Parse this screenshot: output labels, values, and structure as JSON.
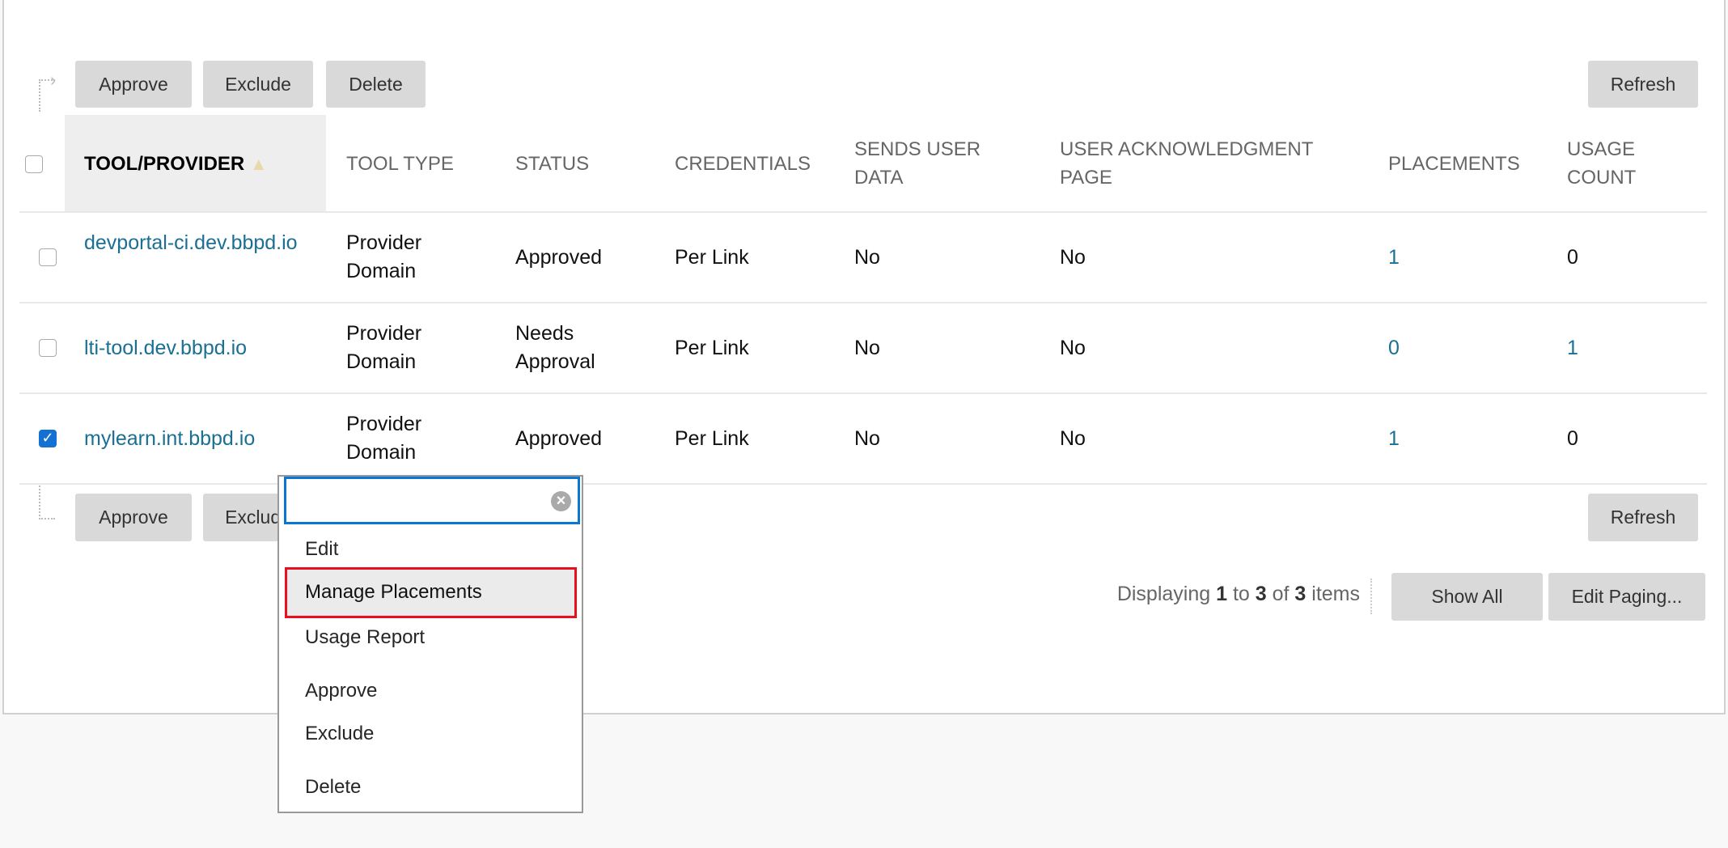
{
  "toolbar": {
    "approve": "Approve",
    "exclude": "Exclude",
    "delete": "Delete",
    "refresh": "Refresh"
  },
  "columns": [
    "TOOL/PROVIDER",
    "TOOL TYPE",
    "STATUS",
    "CREDENTIALS",
    "SENDS USER DATA",
    "USER ACKNOWLEDGMENT PAGE",
    "PLACEMENTS",
    "USAGE COUNT"
  ],
  "columns_lines": {
    "sends": [
      "SENDS USER",
      "DATA"
    ],
    "ack": [
      "USER ACKNOWLEDGMENT",
      "PAGE"
    ],
    "usage": [
      "USAGE",
      "COUNT"
    ]
  },
  "sort": {
    "column": "TOOL/PROVIDER",
    "direction": "ascending",
    "icon": "sort-up-triangle-icon"
  },
  "rows": [
    {
      "checked": false,
      "tool": "devportal-ci.dev.bbpd.io",
      "type": [
        "Provider",
        "Domain"
      ],
      "status": [
        "Approved"
      ],
      "credentials": "Per Link",
      "sends": "No",
      "ack": "No",
      "placements": "1",
      "usage": "0"
    },
    {
      "checked": false,
      "tool": "lti-tool.dev.bbpd.io",
      "type": [
        "Provider",
        "Domain"
      ],
      "status": [
        "Needs",
        "Approval"
      ],
      "credentials": "Per Link",
      "sends": "No",
      "ack": "No",
      "placements": "0",
      "usage": "1"
    },
    {
      "checked": true,
      "tool": "mylearn.int.bbpd.io",
      "type": [
        "Provider",
        "Domain"
      ],
      "status": [
        "Approved"
      ],
      "credentials": "Per Link",
      "sends": "No",
      "ack": "No",
      "placements": "1",
      "usage": "0"
    }
  ],
  "menu": {
    "search_value": "",
    "items": [
      "Edit",
      "Manage Placements",
      "Usage Report",
      "Approve",
      "Exclude",
      "Delete"
    ],
    "highlighted": "Manage Placements"
  },
  "paging": {
    "prefix": "Displaying ",
    "from": "1",
    "to_word": " to ",
    "to": "3",
    "of_word": " of ",
    "total": "3",
    "suffix": " items",
    "show_all": "Show All",
    "edit_paging": "Edit Paging..."
  },
  "colors": {
    "link": "#1a6f94",
    "focus": "#0a78d2",
    "highlight_border": "#e8101e"
  }
}
